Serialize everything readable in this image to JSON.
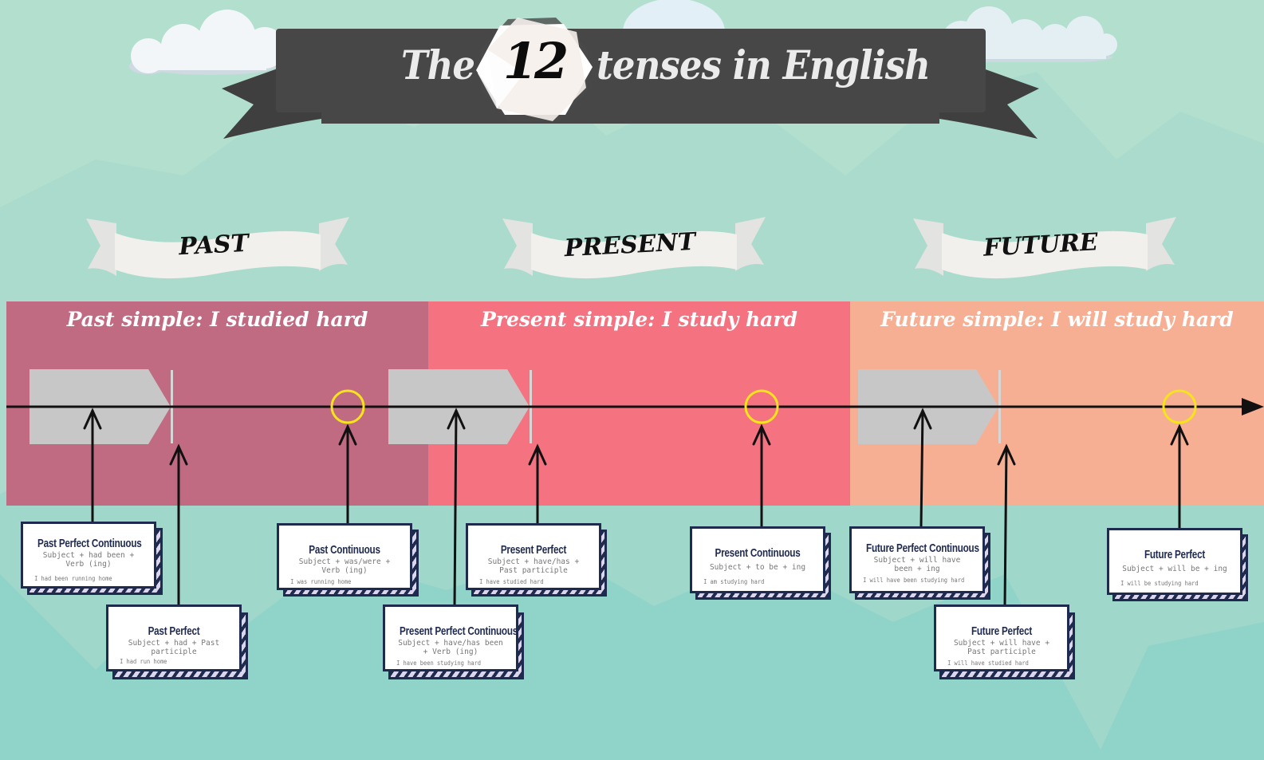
{
  "title": {
    "prefix": "The",
    "number": "12",
    "suffix": "tenses in English"
  },
  "colors": {
    "background": "#b2dfce",
    "title_banner": "#474747",
    "ribbon": "#f1f0ed",
    "past_band": "#c16b83",
    "present_band": "#f57281",
    "future_band": "#f7af94",
    "marker_circle": "#f5e31b",
    "card_border": "#1f2a4f",
    "card_stripe": "#dcd6ec",
    "arrow_block": "#c7c7c7"
  },
  "eras": [
    {
      "label": "PAST",
      "simple": "Past simple: I studied hard"
    },
    {
      "label": "PRESENT",
      "simple": "Present simple: I study hard"
    },
    {
      "label": "FUTURE",
      "simple": "Future simple: I will study hard"
    }
  ],
  "cards": [
    {
      "title": "Past Perfect Continuous",
      "formula": "Subject + had been + Verb (ing)",
      "example": "I had been running home"
    },
    {
      "title": "Past Perfect",
      "formula": "Subject + had + Past participle",
      "example": "I had run home"
    },
    {
      "title": "Past Continuous",
      "formula": "Subject + was/were + Verb (ing)",
      "example": "I was running home"
    },
    {
      "title": "Present Perfect Continuous",
      "formula": "Subject + have/has been + Verb (ing)",
      "example": "I have been studying hard"
    },
    {
      "title": "Present Perfect",
      "formula": "Subject + have/has + Past participle",
      "example": "I have studied hard"
    },
    {
      "title": "Present Continuous",
      "formula": "Subject + to be + ing",
      "example": "I am studying hard"
    },
    {
      "title": "Future Perfect Continuous",
      "formula": "Subject + will have been + ing",
      "example": "I will have been studying hard"
    },
    {
      "title": "Future Perfect",
      "formula": "Subject + will have + Past participle",
      "example": "I will have studied hard"
    },
    {
      "title": "Future Perfect",
      "formula": "Subject + will be + ing",
      "example": "I will be studying hard"
    }
  ]
}
